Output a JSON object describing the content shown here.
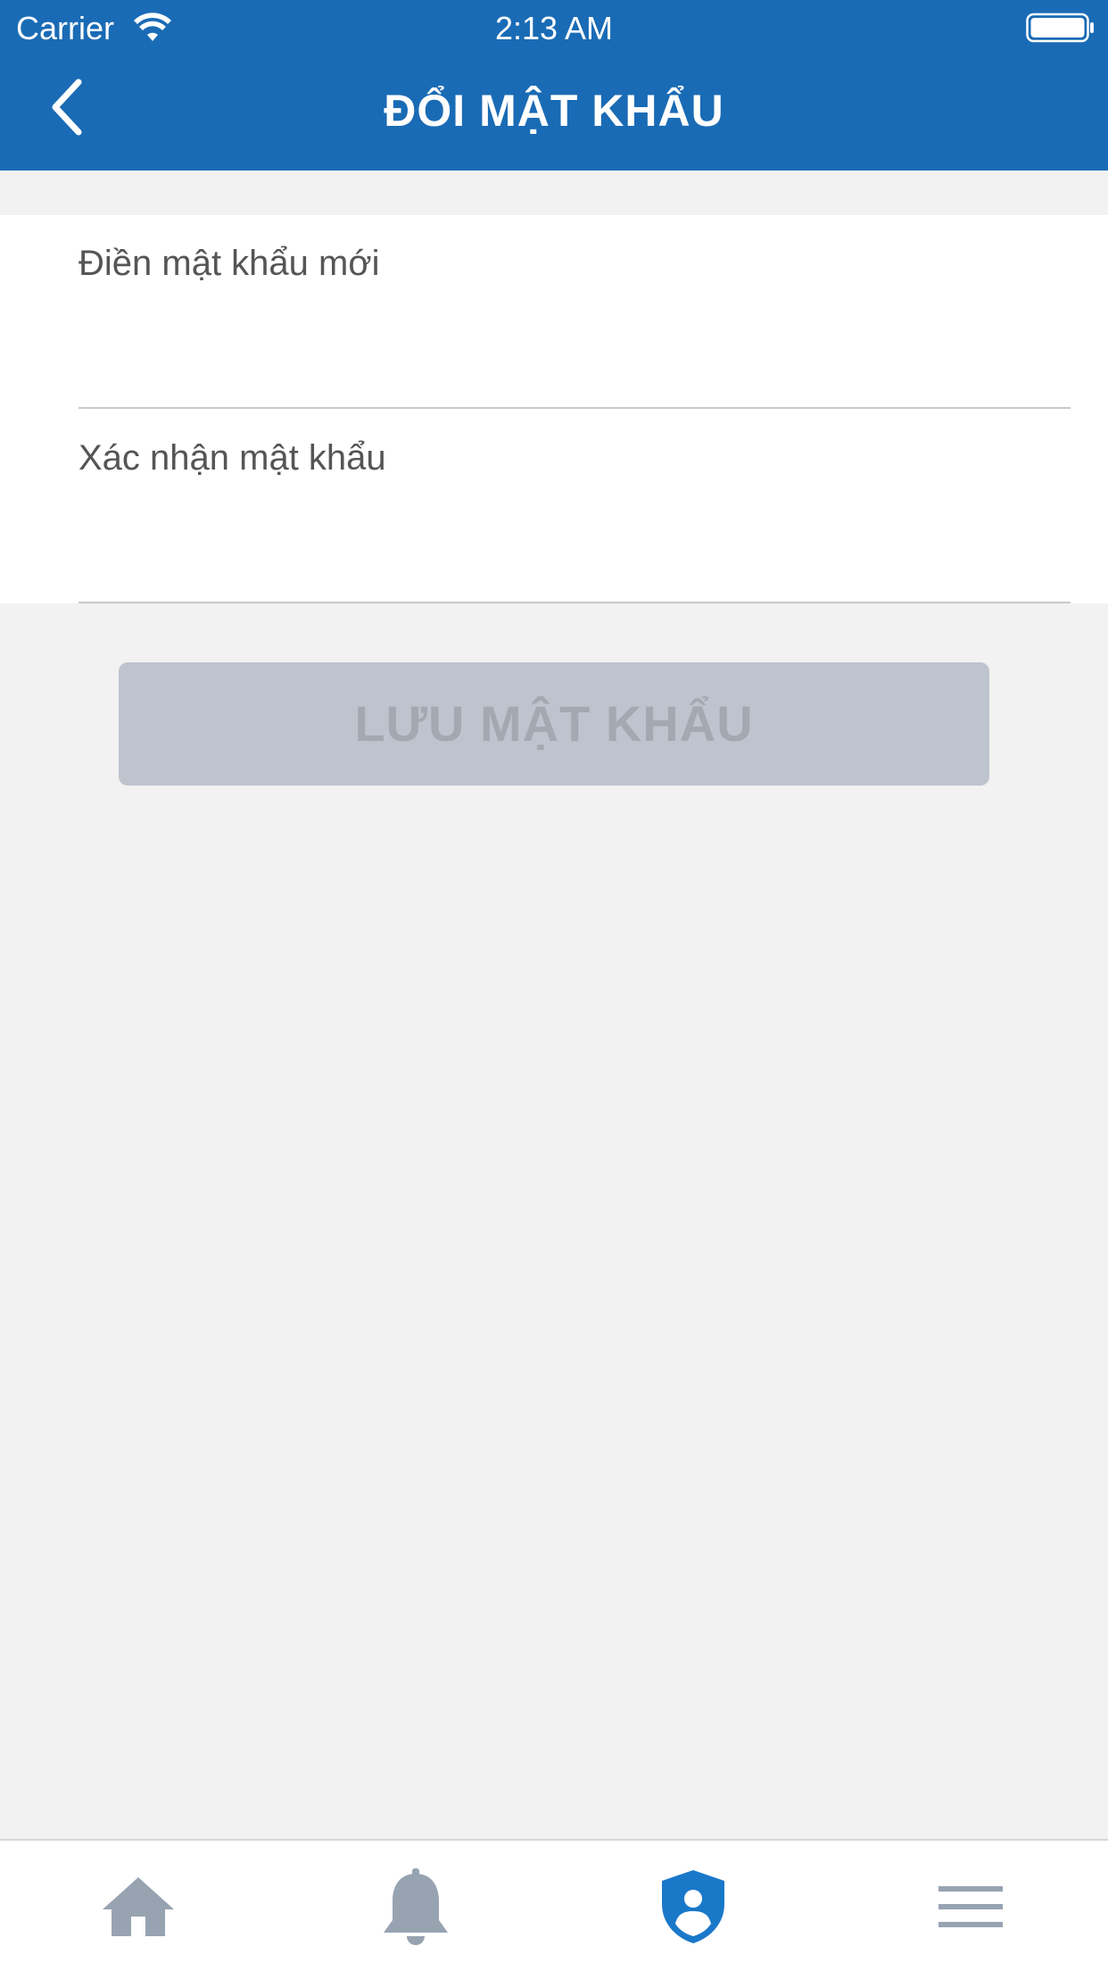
{
  "status_bar": {
    "carrier": "Carrier",
    "time": "2:13 AM"
  },
  "nav": {
    "title": "ĐỔI MẬT KHẨU",
    "back_icon": "chevron-left-icon"
  },
  "form": {
    "new_password": {
      "label": "Điền mật khẩu mới",
      "value": ""
    },
    "confirm_password": {
      "label": "Xác nhận mật khẩu",
      "value": ""
    }
  },
  "save_button": {
    "label": "LƯU MẬT KHẨU",
    "enabled": false
  },
  "tabbar": {
    "items": [
      {
        "icon": "home-icon",
        "active": false
      },
      {
        "icon": "bell-icon",
        "active": false
      },
      {
        "icon": "shield-user-icon",
        "active": true
      },
      {
        "icon": "menu-icon",
        "active": false
      }
    ]
  },
  "colors": {
    "primary": "#1a6bb5",
    "active_tab": "#1a78c9",
    "inactive_tab": "#97a3b1",
    "background": "#f2f2f2",
    "disabled_button": "#bec4cd",
    "disabled_button_text": "#a3a9b1"
  }
}
